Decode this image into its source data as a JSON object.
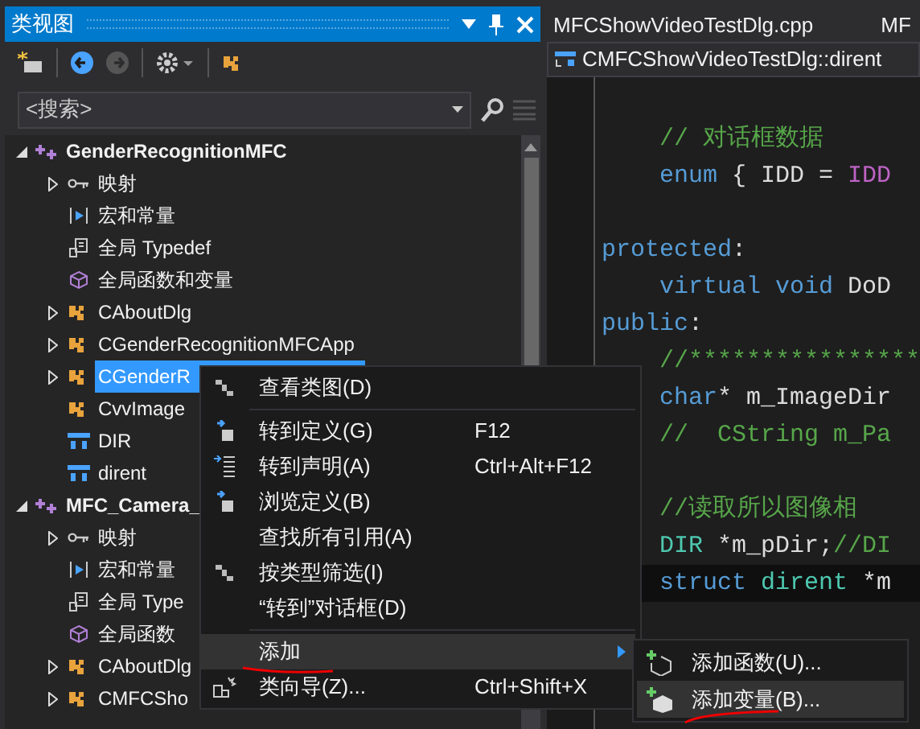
{
  "panel": {
    "title": "类视图",
    "search": {
      "placeholder": "<搜索>"
    },
    "tree": [
      {
        "label": "GenderRecognitionMFC",
        "kind": "project",
        "expanded": true,
        "selected": false,
        "children": [
          {
            "label": "映射",
            "kind": "map",
            "expanded": false,
            "selected": false
          },
          {
            "label": "宏和常量",
            "kind": "macro",
            "selected": false
          },
          {
            "label": "全局 Typedef",
            "kind": "typedef",
            "selected": false
          },
          {
            "label": "全局函数和变量",
            "kind": "globals",
            "selected": false
          },
          {
            "label": "CAboutDlg",
            "kind": "class",
            "expanded": false,
            "selected": false
          },
          {
            "label": "CGenderRecognitionMFCApp",
            "kind": "class",
            "expanded": false,
            "selected": false
          },
          {
            "label": "CGenderR",
            "kind": "class",
            "expanded": false,
            "selected": true
          },
          {
            "label": "CvvImage",
            "kind": "class",
            "selected": false
          },
          {
            "label": "DIR",
            "kind": "struct",
            "selected": false
          },
          {
            "label": "dirent",
            "kind": "struct",
            "selected": false
          }
        ]
      },
      {
        "label": "MFC_Camera_",
        "kind": "project",
        "expanded": true,
        "selected": false,
        "children": [
          {
            "label": "映射",
            "kind": "map",
            "expanded": false,
            "selected": false
          },
          {
            "label": "宏和常量",
            "kind": "macro",
            "selected": false
          },
          {
            "label": "全局 Type",
            "kind": "typedef",
            "selected": false
          },
          {
            "label": "全局函数",
            "kind": "globals",
            "selected": false
          },
          {
            "label": "CAboutDlg",
            "kind": "class",
            "expanded": false,
            "selected": false
          },
          {
            "label": "CMFCSho",
            "kind": "class",
            "expanded": false,
            "selected": false
          }
        ]
      }
    ]
  },
  "editor": {
    "tabs": [
      {
        "label": "MFCShowVideoTestDlg.cpp",
        "selected": false
      },
      {
        "label": "MF",
        "selected": false
      }
    ],
    "navigation": "CMFCShowVideoTestDlg::dirent",
    "lines": [
      {
        "kind": "blank"
      },
      {
        "kind": "code",
        "indent": true,
        "highlight": false,
        "tokens": [
          {
            "text": "// 对话框数据",
            "kind": "comment"
          }
        ]
      },
      {
        "kind": "code",
        "indent": true,
        "highlight": false,
        "tokens": [
          {
            "text": "enum",
            "kind": "keyword"
          },
          {
            "text": " { IDD = ",
            "kind": "plain"
          },
          {
            "text": "IDD",
            "kind": "macro"
          }
        ]
      },
      {
        "kind": "blank"
      },
      {
        "kind": "code",
        "indent": false,
        "highlight": false,
        "tokens": [
          {
            "text": "protected",
            "kind": "keyword"
          },
          {
            "text": ":",
            "kind": "plain"
          }
        ]
      },
      {
        "kind": "code",
        "indent": true,
        "highlight": false,
        "tokens": [
          {
            "text": "virtual void",
            "kind": "keyword"
          },
          {
            "text": " DoD",
            "kind": "plain"
          }
        ]
      },
      {
        "kind": "code",
        "indent": false,
        "highlight": false,
        "tokens": [
          {
            "text": "public",
            "kind": "keyword"
          },
          {
            "text": ":",
            "kind": "plain"
          }
        ]
      },
      {
        "kind": "code",
        "indent": true,
        "highlight": false,
        "tokens": [
          {
            "text": "//****************",
            "kind": "comment"
          }
        ]
      },
      {
        "kind": "code",
        "indent": true,
        "highlight": false,
        "tokens": [
          {
            "text": "char",
            "kind": "keyword"
          },
          {
            "text": "* m_ImageDir",
            "kind": "plain"
          }
        ]
      },
      {
        "kind": "code",
        "indent": true,
        "highlight": false,
        "tokens": [
          {
            "text": "//  CString m_Pa",
            "kind": "comment"
          }
        ]
      },
      {
        "kind": "blank"
      },
      {
        "kind": "code",
        "indent": true,
        "highlight": false,
        "tokens": [
          {
            "text": "//读取所以图像相",
            "kind": "comment"
          }
        ]
      },
      {
        "kind": "code",
        "indent": true,
        "highlight": false,
        "tokens": [
          {
            "text": "DIR",
            "kind": "type"
          },
          {
            "text": " *m_pDir;",
            "kind": "plain"
          },
          {
            "text": "//DI",
            "kind": "comment"
          }
        ]
      },
      {
        "kind": "code",
        "indent": true,
        "highlight": true,
        "tokens": [
          {
            "text": "struct",
            "kind": "keyword"
          },
          {
            "text": " dirent",
            "kind": "type"
          },
          {
            "text": " *m",
            "kind": "plain"
          }
        ]
      }
    ]
  },
  "context_menu": {
    "items": [
      {
        "kind": "diagram",
        "label": "查看类图(D)",
        "selected": false
      },
      {
        "kind": "separator"
      },
      {
        "kind": "goto",
        "label": "转到定义(G)",
        "shortcut": "F12",
        "selected": false
      },
      {
        "kind": "declaration",
        "label": "转到声明(A)",
        "shortcut": "Ctrl+Alt+F12",
        "selected": false
      },
      {
        "kind": "goto",
        "label": "浏览定义(B)",
        "selected": false
      },
      {
        "kind": "plain",
        "label": "查找所有引用(A)",
        "selected": false
      },
      {
        "kind": "diagram",
        "label": "按类型筛选(I)",
        "selected": false
      },
      {
        "kind": "plain",
        "label": "“转到”对话框(D)",
        "selected": false
      },
      {
        "kind": "separator"
      },
      {
        "kind": "submenu",
        "label": "添加",
        "selected": true
      },
      {
        "kind": "wizard",
        "label": "类向导(Z)...",
        "shortcut": "Ctrl+Shift+X",
        "selected": false
      }
    ]
  },
  "submenu": {
    "items": [
      {
        "kind": "function",
        "label": "添加函数(U)...",
        "selected": false
      },
      {
        "kind": "variable",
        "label": "添加变量(B)...",
        "selected": true
      }
    ]
  }
}
